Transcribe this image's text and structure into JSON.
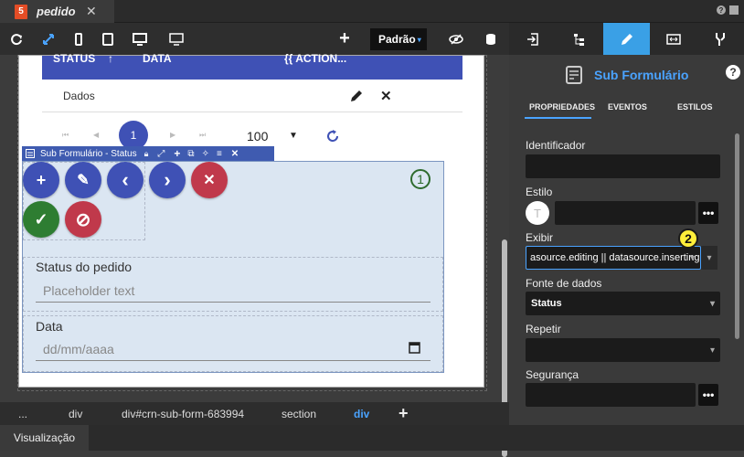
{
  "tab": {
    "badge": "5",
    "label": "pedido",
    "close": "✕"
  },
  "window_icons": {
    "help": "?"
  },
  "toolbar": {
    "add": "+",
    "preset": "Padrão",
    "preset_caret": "▾"
  },
  "right_toolbar": {
    "active_index": 3
  },
  "panel": {
    "title": "Sub Formulário",
    "help": "?",
    "tabs": [
      "PROPRIEDADES",
      "EVENTOS",
      "ESTILOS"
    ],
    "fields": {
      "identificador": {
        "label": "Identificador",
        "value": ""
      },
      "estilo": {
        "label": "Estilo",
        "value": "",
        "badge": "T"
      },
      "exibir": {
        "label": "Exibir",
        "value": "asource.editing || datasource.inserting"
      },
      "fonte": {
        "label": "Fonte de dados",
        "value": "Status"
      },
      "repetir": {
        "label": "Repetir",
        "value": ""
      },
      "seguranca": {
        "label": "Segurança",
        "value": ""
      }
    },
    "dots": "•••",
    "marker2": "2"
  },
  "grid": {
    "headers": [
      "STATUS",
      "DATA",
      "{{ ACTION..."
    ],
    "row_label": "Dados",
    "pager": {
      "first": "⏮",
      "prev": "◀",
      "page": "1",
      "next": "▶",
      "last": "⏭",
      "size": "100",
      "size_caret": "▼"
    }
  },
  "subform": {
    "bar_label": "Sub Formulário - Status",
    "marker1": "1",
    "buttons": [
      "+",
      "✎",
      "‹",
      "›",
      "✕",
      "✓",
      "⊘"
    ],
    "status": {
      "label": "Status do pedido",
      "placeholder": "Placeholder text"
    },
    "date": {
      "label": "Data",
      "placeholder": "dd/mm/aaaa"
    }
  },
  "breadcrumbs": [
    "...",
    "div",
    "div#crn-sub-form-683994",
    "section",
    "div",
    "+"
  ],
  "statusbar": {
    "tab": "Visualização"
  },
  "colors": {
    "accent": "#4aa3ff",
    "primary": "#3f51b5",
    "success": "#2e7d32",
    "danger": "#c0394b"
  }
}
